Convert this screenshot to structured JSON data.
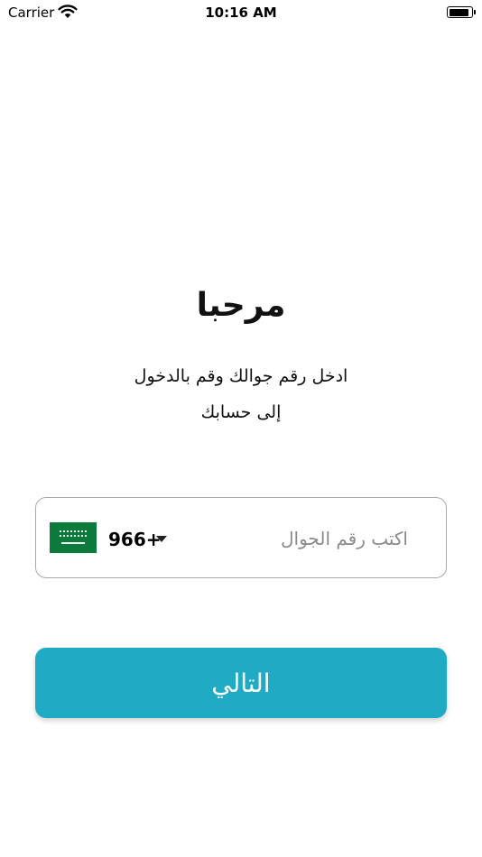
{
  "status_bar": {
    "carrier": "Carrier",
    "time": "10:16 AM",
    "battery_level": 0.9
  },
  "welcome": {
    "title": "مرحبا",
    "subtitle_line1": "ادخل رقم جوالك  وقم بالدخول",
    "subtitle_line2": "إلى حسابك"
  },
  "phone_field": {
    "country_flag": "saudi-arabia-flag",
    "dial_code": "966+",
    "placeholder": "اكتب رقم الجوال",
    "value": ""
  },
  "actions": {
    "next_label": "التالي"
  },
  "colors": {
    "accent": "#1eabc3",
    "border": "#a9a9a9",
    "flag_green": "#0b7a3b"
  }
}
